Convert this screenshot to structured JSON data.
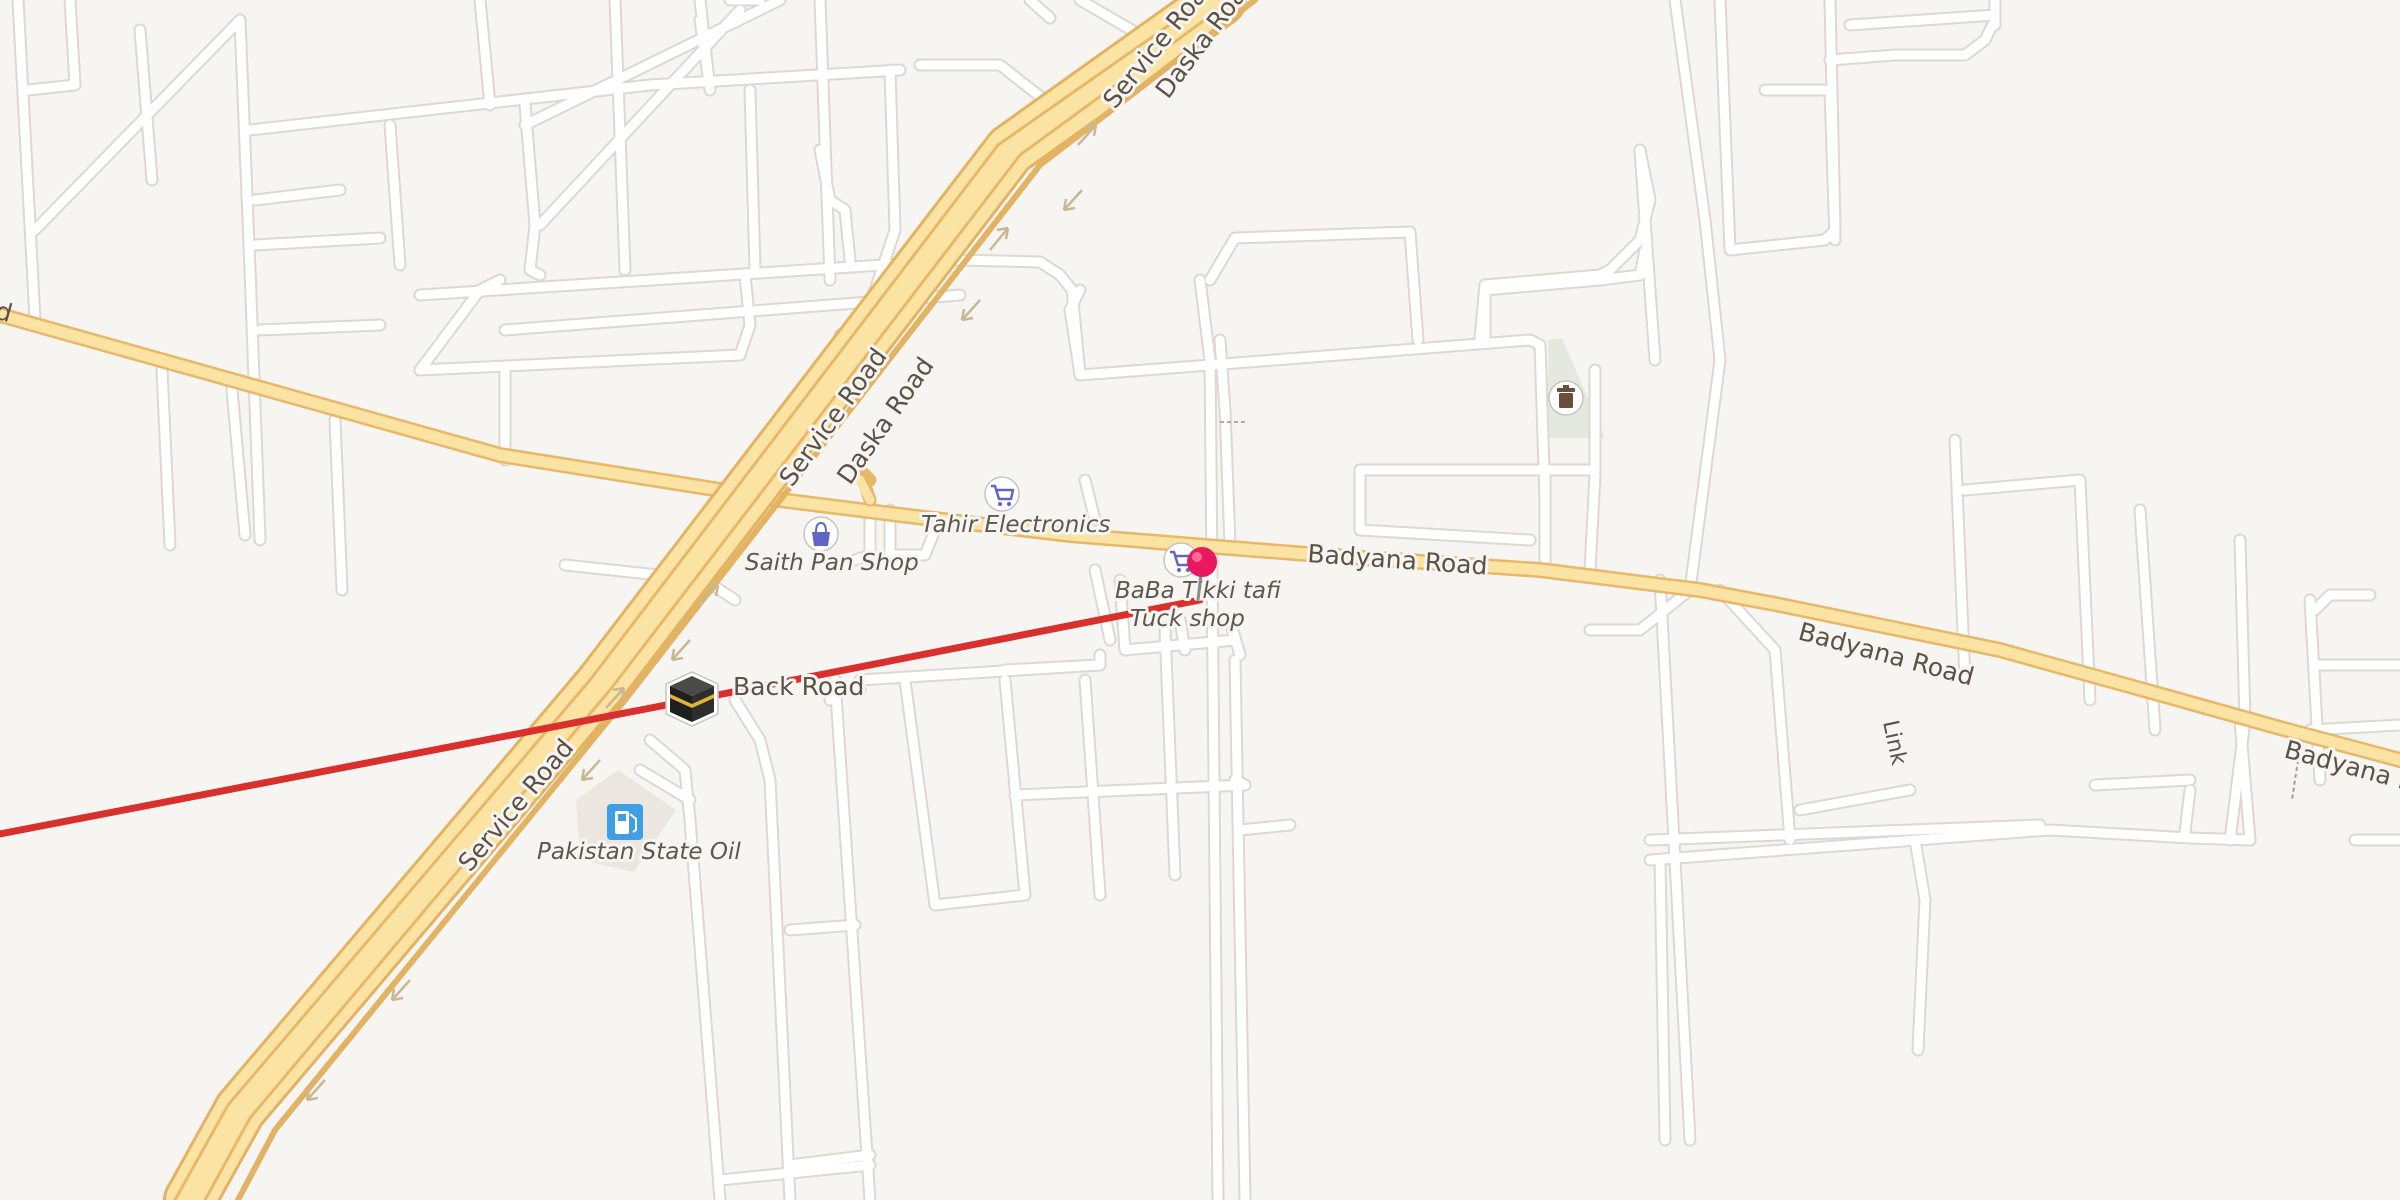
{
  "map": {
    "route_color": "#d9302e",
    "highway_color": "#f8dfa0",
    "highway_casing": "#e6b96a",
    "minor_road_color": "#ffffff",
    "minor_road_casing": "#dbd7d2",
    "background": "#f7f5f2"
  },
  "roads": {
    "service_road_1": "Service Road",
    "daska_road_1": "Daska Road",
    "service_road_2": "Service Road",
    "daska_road_2": "Daska Road",
    "service_road_3": "Service Road",
    "badyana_road_1": "Badyana Road",
    "badyana_road_2": "Badyana Road",
    "badyana_road_3": "Badyana R",
    "back_road": "Back Road",
    "link": "Link",
    "left_edge_fragment": "d"
  },
  "pois": {
    "saith_pan_shop": {
      "label": "Saith Pan Shop",
      "icon": "shopping-bag-icon"
    },
    "tahir_electronics": {
      "label": "Tahir Electronics",
      "icon": "shopping-cart-icon"
    },
    "baba_tikki_tafi": {
      "label_line1": "BaBa Tikki tafi",
      "label_line2": "Tuck shop",
      "icon": "shopping-cart-icon"
    },
    "pakistan_state_oil": {
      "label": "Pakistan State Oil",
      "icon": "fuel-pump-icon"
    },
    "cemetery": {
      "icon": "trash-bin-icon"
    },
    "kaaba": {
      "icon": "kaaba-icon"
    },
    "destination": {
      "icon": "map-pin-icon",
      "color": "#e8195e"
    }
  }
}
